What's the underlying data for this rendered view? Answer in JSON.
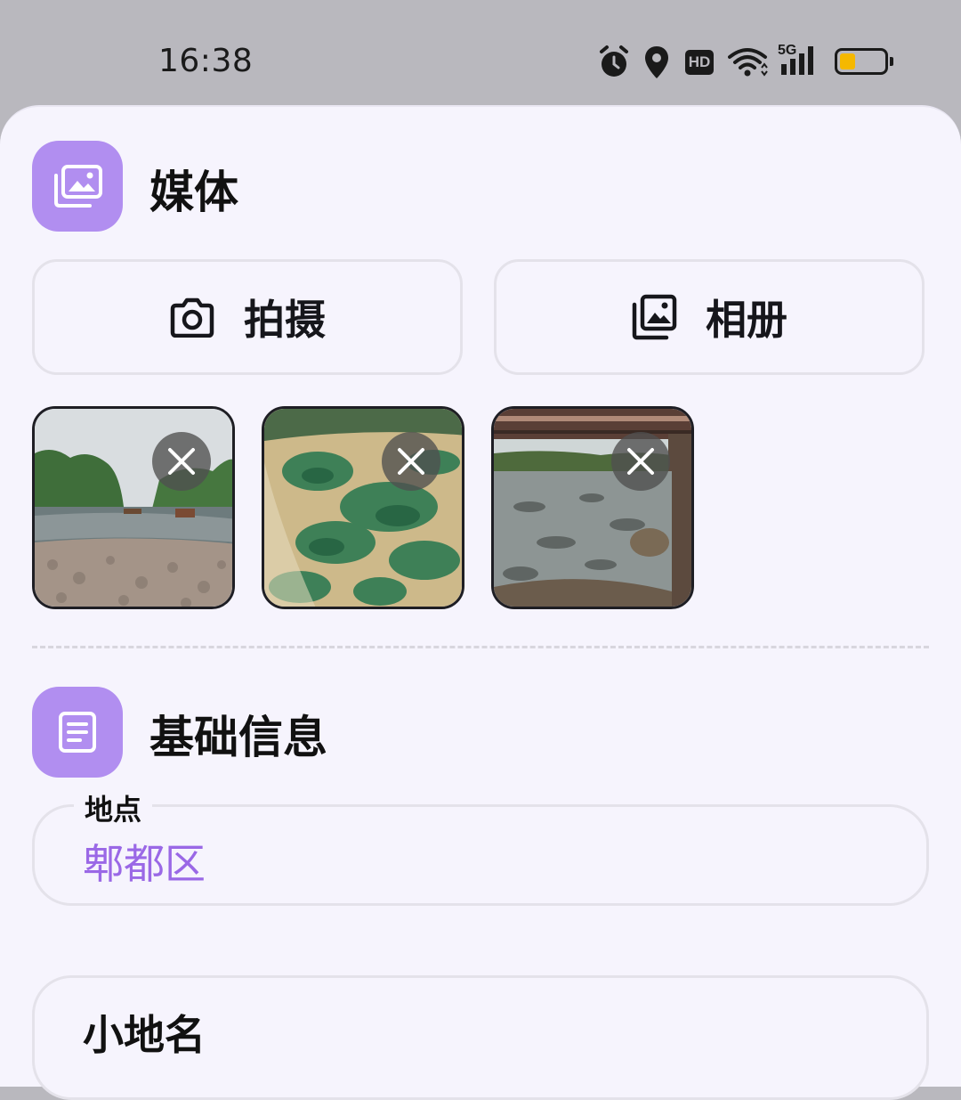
{
  "status_bar": {
    "time": "16:38",
    "icons": [
      "alarm-icon",
      "location-icon",
      "hd-icon",
      "wifi-icon",
      "5g-signal-icon",
      "battery-icon"
    ],
    "hd_label": "HD",
    "network_label": "5G",
    "battery_level": 0.35,
    "battery_color": "#f5b800"
  },
  "media": {
    "title": "媒体",
    "icon": "photo-library-icon",
    "camera_button": "拍摄",
    "album_button": "相册",
    "photos": [
      {
        "description": "river-with-cobblestones"
      },
      {
        "description": "green-algae-water"
      },
      {
        "description": "river-under-bridge"
      }
    ]
  },
  "basic_info": {
    "title": "基础信息",
    "icon": "document-icon",
    "location_label": "地点",
    "location_value": "郫都区",
    "place_name_label": "小地名"
  },
  "colors": {
    "accent": "#b18ef0",
    "value_text": "#9a68e6",
    "sheet_background": "#f6f4fd",
    "status_background": "#b9b8be"
  }
}
